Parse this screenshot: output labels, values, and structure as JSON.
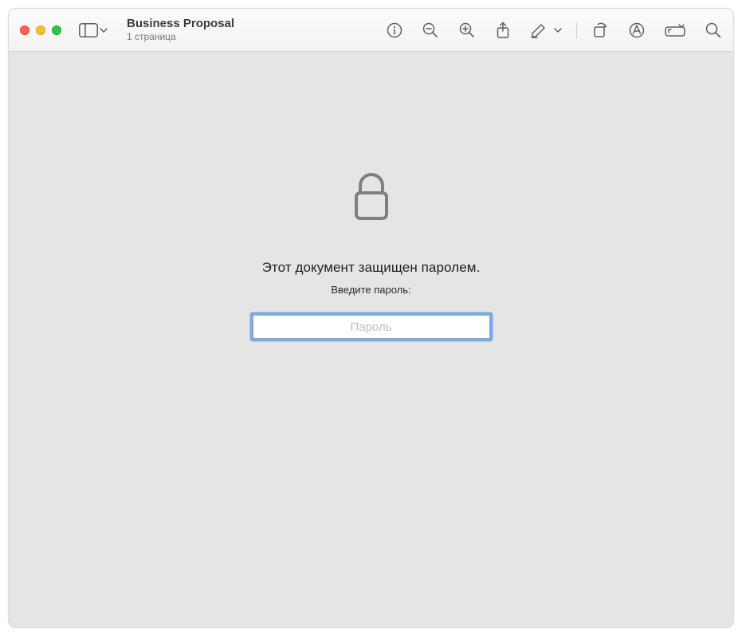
{
  "header": {
    "title": "Business Proposal",
    "subtitle": "1 страница"
  },
  "toolbar": {
    "icons": {
      "sidebar": "sidebar-toggle-icon",
      "info": "info-icon",
      "zoom_out": "zoom-out-icon",
      "zoom_in": "zoom-in-icon",
      "share": "share-icon",
      "highlight": "highlight-icon",
      "rotate": "rotate-icon",
      "markup": "markup-icon",
      "form": "form-icon",
      "search": "search-icon"
    }
  },
  "main": {
    "lock_icon": "lock-icon",
    "message_primary": "Этот документ защищен паролем.",
    "message_secondary": "Введите пароль:",
    "password_placeholder": "Пароль",
    "password_value": ""
  }
}
